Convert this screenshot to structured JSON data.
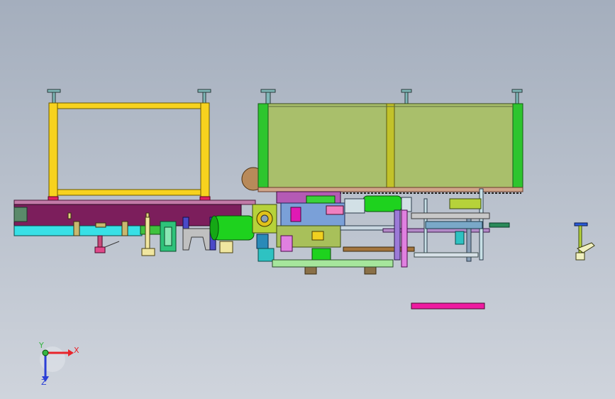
{
  "viewport": {
    "background_top": "#a4aebd",
    "background_bottom": "#cfd4dc"
  },
  "triad": {
    "x_label": "X",
    "y_label": "Y",
    "z_label": "Z",
    "x_color": "#e8242b",
    "y_color": "#35b542",
    "z_color": "#2b3fd6"
  },
  "colors": {
    "yellow_frame": "#f7d21e",
    "olive_guard": "#a9bf6b",
    "green_post": "#2ec52e",
    "maroon_rail": "#7c1e5c",
    "cyan_rail": "#38e0e6",
    "magenta_bar": "#ee1aa0",
    "bright_green": "#1ed21e",
    "light_green": "#a6e69c",
    "brown_rail": "#a3743c",
    "violet": "#9c7ad8"
  }
}
